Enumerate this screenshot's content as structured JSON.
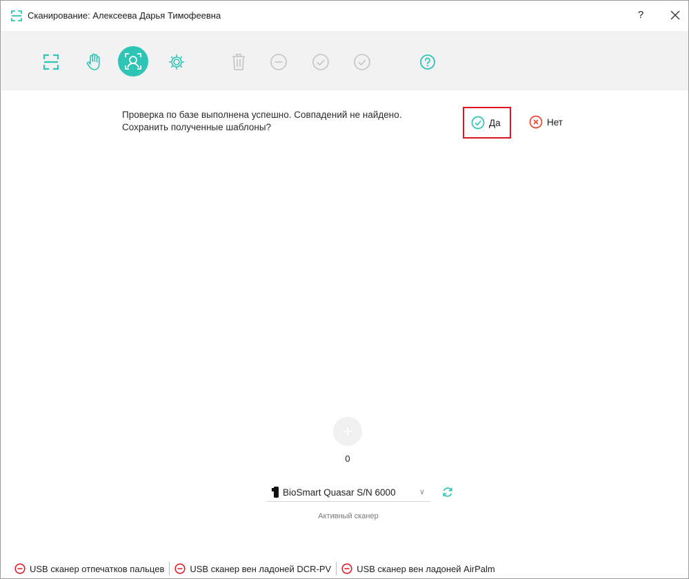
{
  "window": {
    "title": "Сканирование: Алексеева Дарья Тимофеевна",
    "help_label": "?",
    "accent_color": "#2ec4b6",
    "disabled_color": "#c8c8c8",
    "alert_color": "#e0141e"
  },
  "toolbar": {
    "buttons": [
      {
        "icon": "scan-frame-icon",
        "state": "enabled"
      },
      {
        "icon": "hand-icon",
        "state": "enabled"
      },
      {
        "icon": "face-scan-icon",
        "state": "active"
      },
      {
        "icon": "gear-icon",
        "state": "enabled"
      },
      {
        "icon": "trash-icon",
        "state": "disabled"
      },
      {
        "icon": "minus-circle-icon",
        "state": "disabled"
      },
      {
        "icon": "check-circle-icon",
        "state": "disabled"
      },
      {
        "icon": "check-circle-icon",
        "state": "disabled"
      },
      {
        "icon": "help-circle-icon",
        "state": "enabled"
      }
    ]
  },
  "prompt": {
    "line1": "Проверка по базе выполнена успешно. Совпадений не найдено.",
    "line2": "Сохранить полученные шаблоны?",
    "yes_label": "Да",
    "no_label": "Нет"
  },
  "templates": {
    "count": "0"
  },
  "scanner": {
    "selected": "BioSmart Quasar S/N 6000",
    "caption": "Активный сканер"
  },
  "statusbar": {
    "items": [
      {
        "label": "USB сканер отпечатков пальцев",
        "icon": "minus-circle-icon"
      },
      {
        "label": "USB сканер вен ладоней DCR-PV",
        "icon": "minus-circle-icon"
      },
      {
        "label": "USB сканер вен ладоней AirPalm",
        "icon": "minus-circle-icon"
      }
    ]
  }
}
